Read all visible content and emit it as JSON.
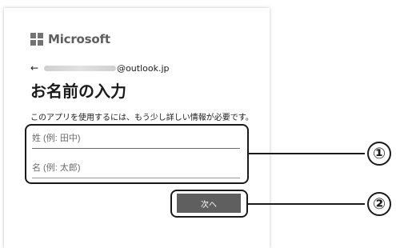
{
  "logo": {
    "text": "Microsoft",
    "colors": [
      "#f25022",
      "#7fba00",
      "#00a4ef",
      "#ffb900"
    ],
    "grid_color": "#737373"
  },
  "identity": {
    "back_icon": "←",
    "email_domain": "@outlook.jp"
  },
  "form": {
    "title": "お名前の入力",
    "description": "このアプリを使用するには、もう少し詳しい情報が必要です。",
    "surname_placeholder": "姓 (例: 田中)",
    "given_name_placeholder": "名 (例: 太郎)",
    "next_label": "次へ"
  },
  "callouts": {
    "one": "①",
    "two": "②"
  },
  "colors": {
    "button_bg": "#5f5f5f",
    "highlight": "#1a1a1a"
  }
}
